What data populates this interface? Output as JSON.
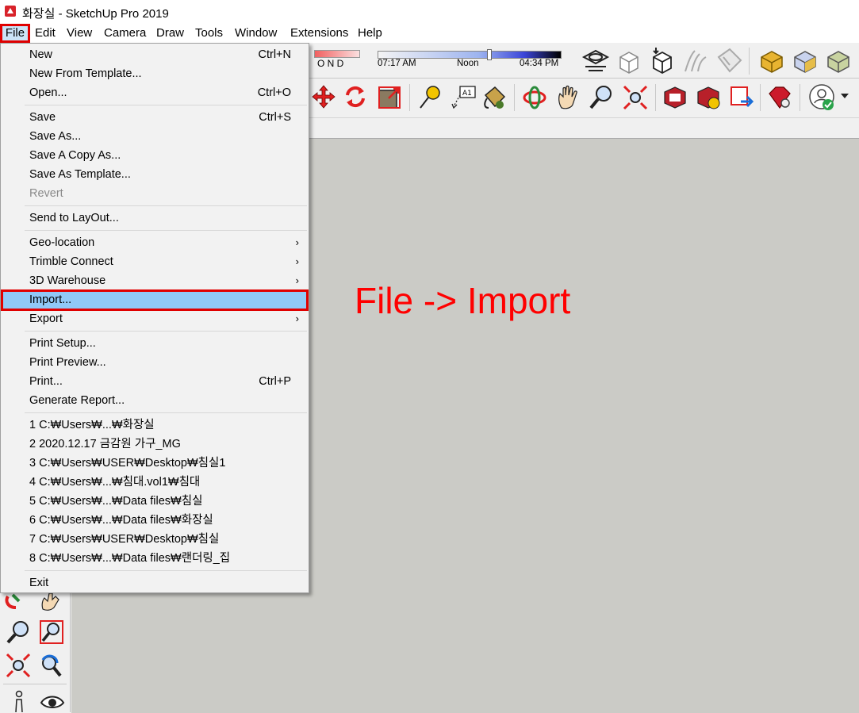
{
  "title": "화장실 - SketchUp Pro 2019",
  "menubar": [
    "File",
    "Edit",
    "View",
    "Camera",
    "Draw",
    "Tools",
    "Window",
    "Extensions",
    "Help"
  ],
  "shadow": {
    "months": "O N D",
    "start": "07:17 AM",
    "mid": "Noon",
    "end": "04:34 PM"
  },
  "annotation": "File -> Import",
  "menu": {
    "new": "New",
    "new_sc": "Ctrl+N",
    "new_template": "New From Template...",
    "open": "Open...",
    "open_sc": "Ctrl+O",
    "save": "Save",
    "save_sc": "Ctrl+S",
    "save_as": "Save As...",
    "save_copy": "Save A Copy As...",
    "save_template": "Save As Template...",
    "revert": "Revert",
    "layout": "Send to LayOut...",
    "geo": "Geo-location",
    "trimble": "Trimble Connect",
    "warehouse": "3D Warehouse",
    "import": "Import...",
    "export": "Export",
    "print_setup": "Print Setup...",
    "print_preview": "Print Preview...",
    "print": "Print...",
    "print_sc": "Ctrl+P",
    "report": "Generate Report...",
    "recent": [
      "1 C:₩Users₩...₩화장실",
      "2 2020.12.17 금감원 가구_MG",
      "3 C:₩Users₩USER₩Desktop₩침실1",
      "4 C:₩Users₩...₩침대.vol1₩침대",
      "5 C:₩Users₩...₩Data files₩침실",
      "6 C:₩Users₩...₩Data files₩화장실",
      "7 C:₩Users₩USER₩Desktop₩침실",
      "8 C:₩Users₩...₩Data files₩랜더링_집"
    ],
    "exit": "Exit",
    "submenu_arrow": "›"
  },
  "colors": {
    "highlight_box": "#e00000",
    "menu_hover": "#91c9f7",
    "canvas": "#cbcbc6",
    "annotation": "#ff0000"
  }
}
